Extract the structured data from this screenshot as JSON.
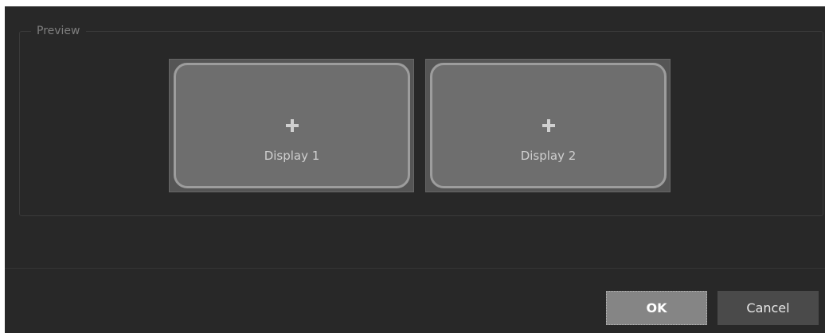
{
  "preview": {
    "legend": "Preview",
    "displays": [
      {
        "label": "Display 1",
        "icon": "plus-icon"
      },
      {
        "label": "Display 2",
        "icon": "plus-icon"
      }
    ]
  },
  "buttons": {
    "ok_label": "OK",
    "cancel_label": "Cancel"
  },
  "colors": {
    "dialog_background": "#282828",
    "display_face": "#6e6e6e",
    "ok_button": "#858585",
    "cancel_button": "#4a4a4a"
  }
}
